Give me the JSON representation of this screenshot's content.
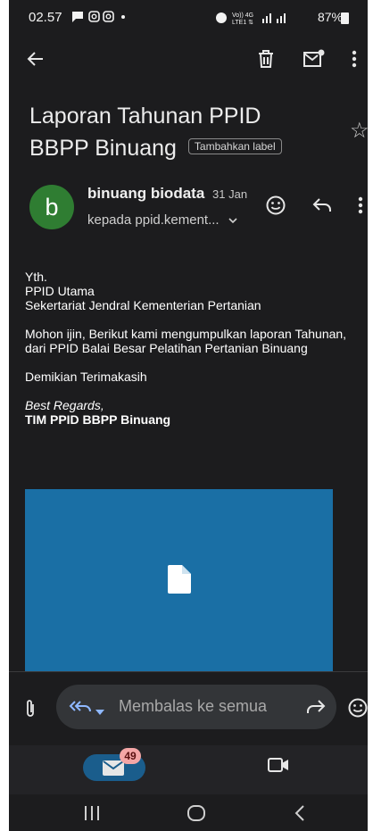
{
  "status_bar": {
    "time": "02.57",
    "left_icons": [
      "chat-bubble-icon",
      "instagram-icon",
      "instagram-icon",
      "dot-icon"
    ],
    "right_text": "Vo)) 4G LTE1 ⇅ .ıl .ıl 87%",
    "battery": "87%"
  },
  "toolbar": {
    "icons": [
      "back-arrow-icon",
      "delete-icon",
      "mark-unread-icon",
      "more-vert-icon"
    ]
  },
  "email": {
    "subject": "Laporan Tahunan PPID BBPP Binuang",
    "label_chip": "Tambahkan label",
    "sender_initial": "b",
    "sender_name": "binuang biodata",
    "date": "31 Jan",
    "recipient": "kepada ppid.kement...",
    "body": {
      "line1": "Yth.",
      "line2": "PPID Utama",
      "line3": "Sekertariat Jendral Kementerian Pertanian",
      "para2_line1": "Mohon ijin, Berikut kami mengumpulkan laporan Tahunan,",
      "para2_line2": "dari PPID Balai Besar Pelatihan Pertanian Binuang",
      "para3": "Demikian Terimakasih",
      "signoff": "Best Regards,",
      "signature": "TIM PPID BBPP Binuang"
    }
  },
  "reply_bar": {
    "placeholder": "Membalas ke semua"
  },
  "bottom_nav": {
    "mail_badge": "49"
  },
  "colors": {
    "background": "#1c1c1e",
    "avatar": "#2f7d32",
    "attachment": "#1a6fa5",
    "mail_tab_active": "#1a5d8c",
    "badge": "#f4a6a6"
  }
}
